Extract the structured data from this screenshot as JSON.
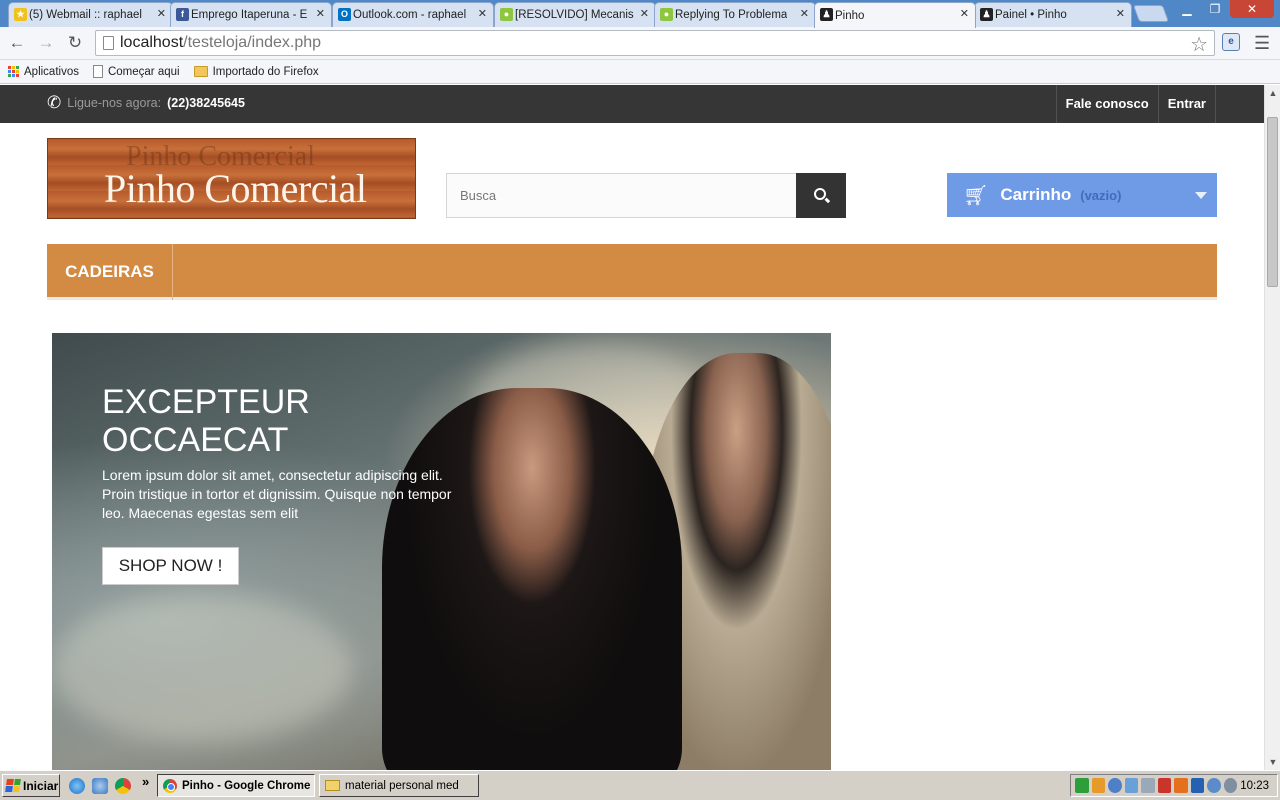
{
  "browser": {
    "tabs": [
      {
        "title": "(5) Webmail :: raphael",
        "favicon_color": "#f2c11c",
        "active": false
      },
      {
        "title": "Emprego Itaperuna - E",
        "favicon_color": "#3b5998",
        "active": false
      },
      {
        "title": "Outlook.com - raphael",
        "favicon_color": "#0072c6",
        "active": false
      },
      {
        "title": "[RESOLVIDO] Mecanis",
        "favicon_color": "#8dc63f",
        "active": false
      },
      {
        "title": "Replying To Problema",
        "favicon_color": "#8dc63f",
        "active": false
      },
      {
        "title": "Pinho",
        "favicon_color": "#222222",
        "active": true
      },
      {
        "title": "Painel • Pinho",
        "favicon_color": "#222222",
        "active": false
      }
    ],
    "url_host": "localhost",
    "url_path": "/testeloja/index.php",
    "bookmarks": {
      "apps": "Aplicativos",
      "start": "Começar aqui",
      "firefox": "Importado do Firefox"
    }
  },
  "shop": {
    "topbar": {
      "call_label": "Ligue-nos agora:",
      "phone": "(22)38245645",
      "contact": "Fale conosco",
      "login": "Entrar"
    },
    "logo": {
      "name": "Pinho Comercial",
      "ghost": "Pinho Comercial"
    },
    "search": {
      "placeholder": "Busca"
    },
    "cart": {
      "label": "Carrinho",
      "status": "(vazio)"
    },
    "menu": {
      "item": "CADEIRAS"
    },
    "hero": {
      "title_line1": "EXCEPTEUR",
      "title_line2": "OCCAECAT",
      "text": "Lorem ipsum dolor sit amet, consectetur adipiscing elit. Proin tristique in tortor et dignissim. Quisque non tempor leo. Maecenas egestas sem elit",
      "button": "SHOP NOW !"
    }
  },
  "taskbar": {
    "start": "Iniciar",
    "tasks": [
      {
        "label": "Pinho - Google Chrome",
        "active": true
      },
      {
        "label": "material personal med",
        "active": false
      }
    ],
    "clock": "10:23"
  },
  "colors": {
    "accent_orange": "#d38a43",
    "cart_blue": "#6f9ae6",
    "topbar_dark": "#363636"
  }
}
